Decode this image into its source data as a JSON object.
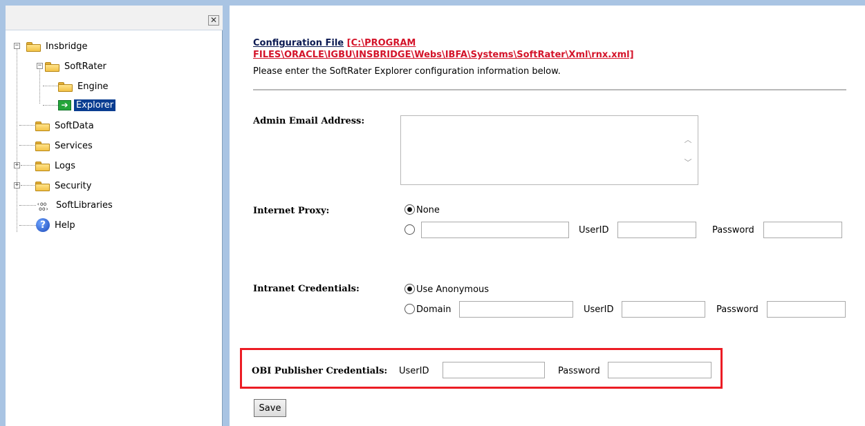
{
  "left_pane": {
    "close_glyph": "✕",
    "tree": [
      {
        "label": "Insbridge",
        "icon": "folder-icon",
        "toggle": "−"
      },
      {
        "label": "SoftRater",
        "icon": "folder-icon",
        "toggle": "−"
      },
      {
        "label": "Engine",
        "icon": "folder-icon"
      },
      {
        "label": "Explorer",
        "icon": "arrow-right-icon",
        "selected": true
      },
      {
        "label": "SoftData",
        "icon": "folder-icon"
      },
      {
        "label": "Services",
        "icon": "folder-icon"
      },
      {
        "label": "Logs",
        "icon": "folder-icon",
        "toggle": "+"
      },
      {
        "label": "Security",
        "icon": "folder-icon",
        "toggle": "+"
      },
      {
        "label": "SoftLibraries",
        "icon": "library-icon"
      },
      {
        "label": "Help",
        "icon": "help-icon"
      }
    ]
  },
  "main": {
    "config_label": "Configuration File",
    "config_path": "[C:\\PROGRAM FILES\\ORACLE\\IGBU\\INSBRIDGE\\Webs\\IBFA\\Systems\\SoftRater\\Xml\\rnx.xml]",
    "instructions": "Please enter the SoftRater Explorer configuration information below.",
    "admin_email": {
      "label": "Admin Email Address:",
      "value": ""
    },
    "internet_proxy": {
      "label": "Internet Proxy:",
      "option_none": "None",
      "userid_label": "UserID",
      "password_label": "Password",
      "selected": "None"
    },
    "intranet": {
      "label": "Intranet Credentials:",
      "option_anonymous": "Use Anonymous",
      "option_domain": "Domain",
      "userid_label": "UserID",
      "password_label": "Password",
      "selected": "Use Anonymous"
    },
    "obi": {
      "label": "OBI Publisher Credentials:",
      "userid_label": "UserID",
      "password_label": "Password"
    },
    "save_label": "Save"
  },
  "colors": {
    "frame": "#a9c4e3",
    "selected": "#0a3d91",
    "path_red": "#d4142a",
    "highlight_red": "#ec1c24"
  }
}
